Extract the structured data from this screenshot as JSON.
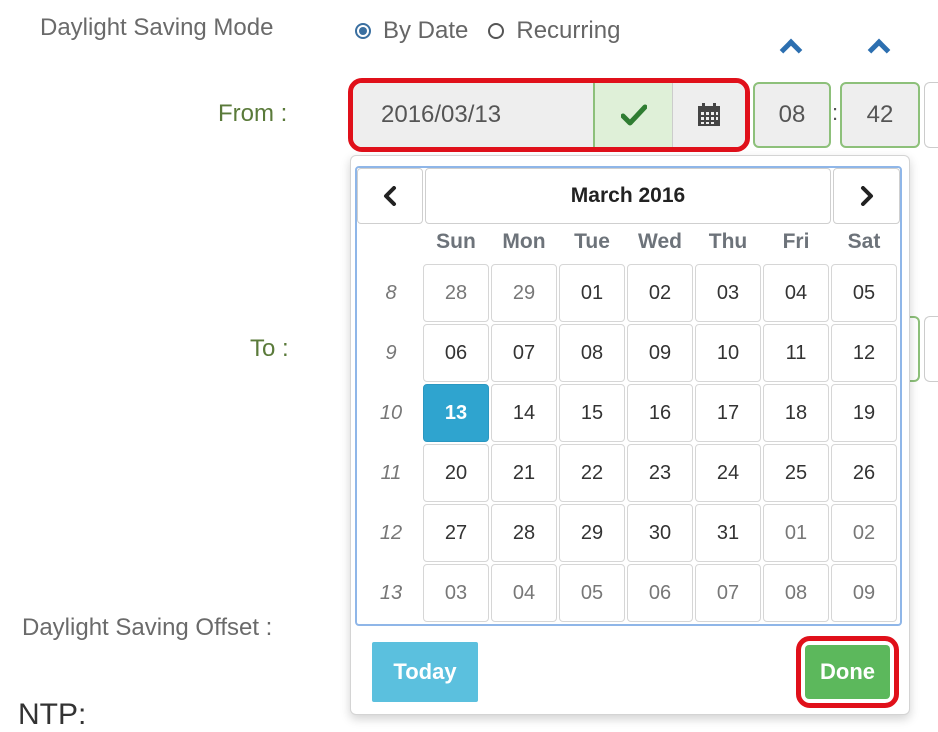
{
  "dst_mode": {
    "label": "Daylight Saving Mode",
    "options": [
      "By Date",
      "Recurring"
    ],
    "selected": "By Date"
  },
  "from": {
    "label": "From :",
    "date": "2016/03/13",
    "hour": "08",
    "minute": "42",
    "separator": ":"
  },
  "to": {
    "label": "To :"
  },
  "offset": {
    "label": "Daylight Saving Offset :"
  },
  "ntp": {
    "label": "NTP:"
  },
  "icons": {
    "check": "check-icon",
    "calendar": "calendar-icon",
    "chevron_up": "chevron-up-icon",
    "prev": "chevron-left-icon",
    "next": "chevron-right-icon"
  },
  "calendar": {
    "month_label": "March 2016",
    "weekdays": [
      "Sun",
      "Mon",
      "Tue",
      "Wed",
      "Thu",
      "Fri",
      "Sat"
    ],
    "weeks": [
      {
        "num": "8",
        "days": [
          "28",
          "29",
          "01",
          "02",
          "03",
          "04",
          "05"
        ]
      },
      {
        "num": "9",
        "days": [
          "06",
          "07",
          "08",
          "09",
          "10",
          "11",
          "12"
        ]
      },
      {
        "num": "10",
        "days": [
          "13",
          "14",
          "15",
          "16",
          "17",
          "18",
          "19"
        ]
      },
      {
        "num": "11",
        "days": [
          "20",
          "21",
          "22",
          "23",
          "24",
          "25",
          "26"
        ]
      },
      {
        "num": "12",
        "days": [
          "27",
          "28",
          "29",
          "30",
          "31",
          "01",
          "02"
        ]
      },
      {
        "num": "13",
        "days": [
          "03",
          "04",
          "05",
          "06",
          "07",
          "08",
          "09"
        ]
      }
    ],
    "selected_day": "13",
    "today_label": "Today",
    "done_label": "Done"
  },
  "colors": {
    "accent": "#2fa4cf",
    "success": "#5cb85c",
    "highlight": "#e0101a",
    "today": "#5bc0de"
  }
}
